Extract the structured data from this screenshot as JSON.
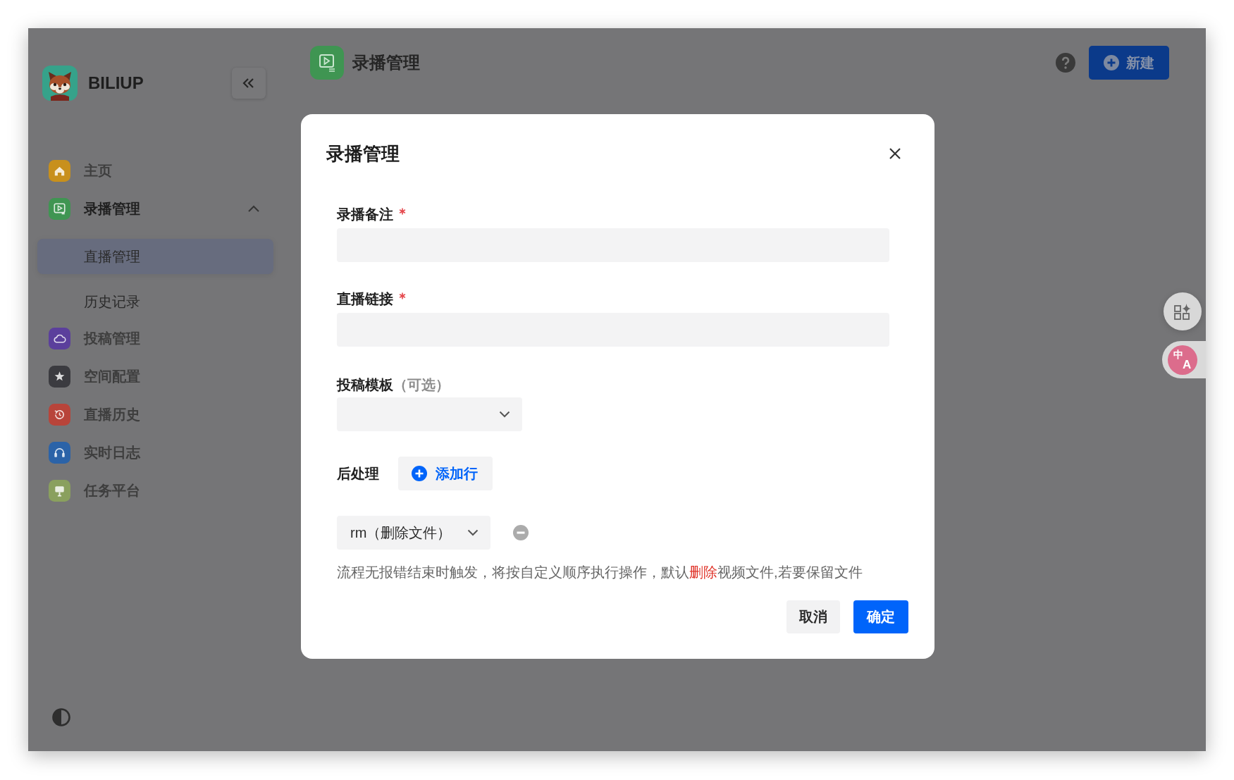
{
  "app": {
    "name": "BILIUP"
  },
  "sidebar": {
    "items": [
      {
        "label": "主页",
        "color": "#c8901c",
        "selected": false
      },
      {
        "label": "录播管理",
        "color": "#3f9552",
        "selected": true,
        "expanded": true,
        "children": [
          {
            "label": "直播管理",
            "selected": true
          },
          {
            "label": "历史记录",
            "selected": false
          }
        ]
      },
      {
        "label": "投稿管理",
        "color": "#5b3f9c",
        "selected": false
      },
      {
        "label": "空间配置",
        "color": "#3b3b40",
        "selected": false
      },
      {
        "label": "直播历史",
        "color": "#b8443a",
        "selected": false
      },
      {
        "label": "实时日志",
        "color": "#2b63a8",
        "selected": false
      },
      {
        "label": "任务平台",
        "color": "#8aa05e",
        "selected": false
      }
    ]
  },
  "header": {
    "title": "录播管理",
    "action": "新建"
  },
  "dialog": {
    "title": "录播管理",
    "fields": [
      {
        "kind": "text",
        "label": "录播备注",
        "required": true
      },
      {
        "kind": "text",
        "label": "直播链接",
        "required": true
      },
      {
        "kind": "select",
        "label": "投稿模板",
        "note": "（可选）",
        "required": false
      }
    ],
    "post_processing": {
      "label": "后处理",
      "add_button": "添加行",
      "rows": [
        {
          "value": "rm（删除文件）"
        }
      ],
      "help_text": [
        {
          "text": "流程无报错结束时触发，将按自定义顺序执行操作，默认",
          "highlight": false
        },
        {
          "text": "删除",
          "highlight": true
        },
        {
          "text": "视频文件,若要保留文件",
          "highlight": false
        }
      ]
    },
    "buttons": [
      {
        "label": "取消",
        "kind": "secondary"
      },
      {
        "label": "确定",
        "kind": "primary"
      }
    ]
  },
  "translate_button": {
    "source": "中",
    "target": "A"
  }
}
